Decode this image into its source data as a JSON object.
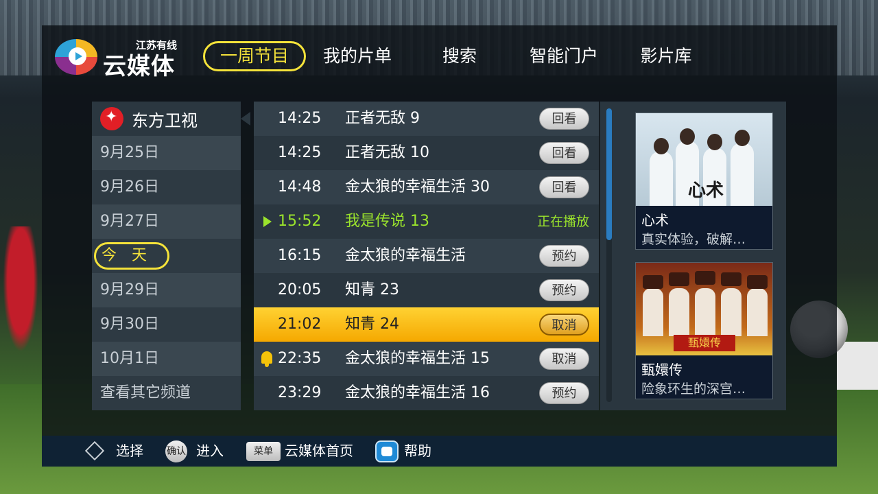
{
  "brand": {
    "small": "江苏有线",
    "big": "云媒体"
  },
  "nav": {
    "items": [
      "一周节目",
      "我的片单",
      "搜索",
      "智能门户",
      "影片库"
    ],
    "active": "一周节目"
  },
  "channel": {
    "name": "东方卫视"
  },
  "dates": [
    "9月25日",
    "9月26日",
    "9月27日",
    "今天",
    "9月29日",
    "9月30日",
    "10月1日",
    "查看其它频道"
  ],
  "schedule": [
    {
      "time": "14:25",
      "title": "正者无敌 9",
      "action": "回看"
    },
    {
      "time": "14:25",
      "title": "正者无敌 10",
      "action": "回看"
    },
    {
      "time": "14:48",
      "title": "金太狼的幸福生活 30",
      "action": "回看"
    },
    {
      "time": "15:52",
      "title": "我是传说 13",
      "status": "正在播放"
    },
    {
      "time": "16:15",
      "title": "金太狼的幸福生活",
      "action": "预约"
    },
    {
      "time": "20:05",
      "title": "知青 23",
      "action": "预约"
    },
    {
      "time": "21:02",
      "title": "知青 24",
      "action": "取消"
    },
    {
      "time": "22:35",
      "title": "金太狼的幸福生活 15",
      "action": "取消"
    },
    {
      "time": "23:29",
      "title": "金太狼的幸福生活 16",
      "action": "预约"
    }
  ],
  "posters": [
    {
      "title": "心术",
      "desc": "真实体验，破解…",
      "image_text": "心术"
    },
    {
      "title": "甄嬛传",
      "desc": "险象环生的深宫…",
      "image_text": "甄嬛传"
    }
  ],
  "footer": {
    "select": "选择",
    "ok_key": "确认",
    "enter": "进入",
    "menu_key": "菜单",
    "home": "云媒体首页",
    "help": "帮助"
  },
  "colors": {
    "accent_yellow": "#f5e33a",
    "playing_green": "#9be42c",
    "selected_orange": "#f5a800"
  }
}
